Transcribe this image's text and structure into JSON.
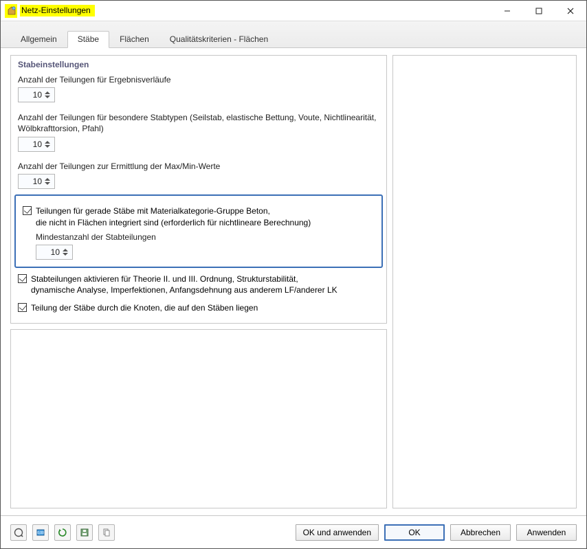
{
  "window": {
    "title": "Netz-Einstellungen"
  },
  "tabs": {
    "items": [
      {
        "label": "Allgemein"
      },
      {
        "label": "Stäbe"
      },
      {
        "label": "Flächen"
      },
      {
        "label": "Qualitätskriterien - Flächen"
      }
    ],
    "active_index": 1
  },
  "group": {
    "title": "Stabeinstellungen",
    "field1": {
      "label": "Anzahl der Teilungen für Ergebnisverläufe",
      "value": "10"
    },
    "field2": {
      "label": "Anzahl der Teilungen für besondere Stabtypen (Seilstab, elastische Bettung, Voute, Nichtlinearität, Wölbkrafttorsion, Pfahl)",
      "value": "10"
    },
    "field3": {
      "label": "Anzahl der Teilungen zur Ermittlung der Max/Min-Werte",
      "value": "10"
    },
    "check1": {
      "line1": "Teilungen für gerade Stäbe mit Materialkategorie-Gruppe Beton,",
      "line2": "die nicht in Flächen integriert sind (erforderlich für nichtlineare Berechnung)",
      "sub_label": "Mindestanzahl der Stabteilungen",
      "value": "10",
      "checked": true
    },
    "check2": {
      "line1": "Stabteilungen aktivieren für Theorie II. und III. Ordnung, Strukturstabilität,",
      "line2": "dynamische Analyse, Imperfektionen, Anfangsdehnung aus anderem LF/anderer LK",
      "checked": true
    },
    "check3": {
      "label": "Teilung der Stäbe durch die Knoten, die auf den Stäben liegen",
      "checked": true
    }
  },
  "footer": {
    "ok_apply": "OK und anwenden",
    "ok": "OK",
    "cancel": "Abbrechen",
    "apply": "Anwenden"
  }
}
